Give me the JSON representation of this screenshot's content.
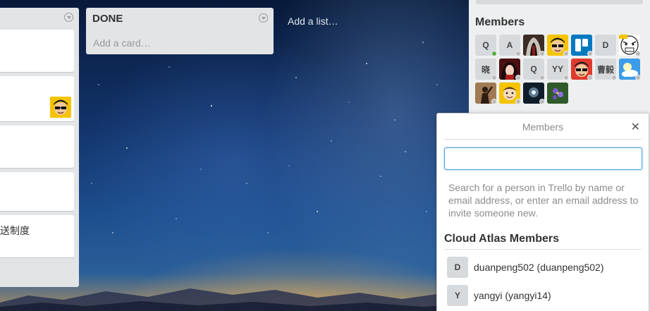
{
  "lists": {
    "partial": {
      "menu_icon": "chevron-down-circle-icon",
      "cards": [
        {
          "title": ""
        },
        {
          "title": "",
          "has_member_avatar": true
        },
        {
          "title": ""
        },
        {
          "title": ""
        },
        {
          "title": "送制度"
        }
      ]
    },
    "done": {
      "name": "DONE",
      "add_card": "Add a card…",
      "menu_icon": "chevron-down-circle-icon"
    },
    "add_list": "Add a list…"
  },
  "sidebar": {
    "members_heading": "Members",
    "members": [
      {
        "initials": "Q",
        "status": "active"
      },
      {
        "initials": "A",
        "status": "inactive"
      },
      {
        "initials": "",
        "status": "inactive",
        "avatar": "hooded-figure"
      },
      {
        "initials": "",
        "status": "inactive",
        "avatar": "sunglasses-cartoon"
      },
      {
        "initials": "",
        "status": "inactive",
        "avatar": "trello-logo"
      },
      {
        "initials": "D",
        "status": "inactive"
      },
      {
        "initials": "",
        "status": "inactive",
        "avatar": "rage-face"
      },
      {
        "initials": "晓",
        "status": "inactive"
      },
      {
        "initials": "",
        "status": "inactive",
        "avatar": "anime-girl"
      },
      {
        "initials": "Q",
        "status": "inactive"
      },
      {
        "initials": "YY",
        "status": "inactive"
      },
      {
        "initials": "",
        "status": "inactive",
        "avatar": "red-cartoon"
      },
      {
        "initials": "曹毅",
        "status": "inactive"
      },
      {
        "initials": "",
        "status": "inactive",
        "avatar": "cloud-bulb"
      },
      {
        "initials": "",
        "status": "inactive",
        "avatar": "silhouette-photo"
      },
      {
        "initials": "",
        "status": "inactive",
        "avatar": "yellow-cartoon"
      },
      {
        "initials": "",
        "status": "inactive",
        "avatar": "glow-photo"
      },
      {
        "initials": "",
        "status": "inactive",
        "avatar": "flower-photo"
      }
    ]
  },
  "popover": {
    "title": "Members",
    "close_icon": "close-icon",
    "search_value": "",
    "hint": "Search for a person in Trello by name or email address, or enter an email address to invite someone new.",
    "section_heading": "Cloud Atlas Members",
    "results": [
      {
        "initials": "D",
        "name": "duanpeng502 (duanpeng502)"
      },
      {
        "initials": "Y",
        "name": "yangyi (yangyi14)"
      }
    ]
  },
  "colors": {
    "list_bg": "#e2e4e6",
    "sidebar_bg": "#edeff0",
    "focus_border": "#4d9fd8",
    "active_dot": "#5aac44"
  }
}
